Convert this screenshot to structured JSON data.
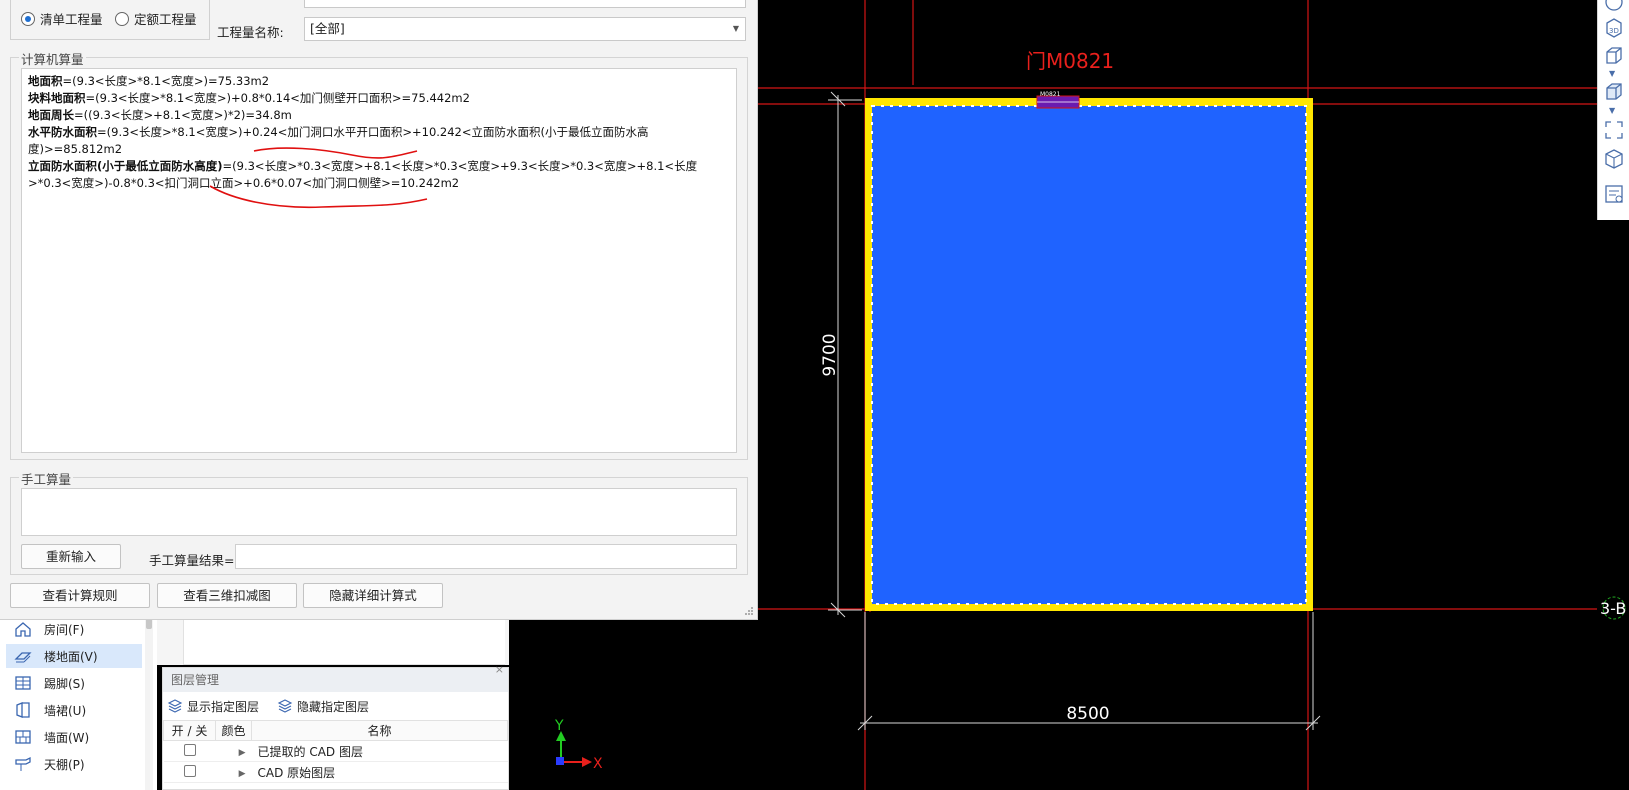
{
  "dialog": {
    "mode_options": [
      {
        "label": "清单工程量",
        "selected": true
      },
      {
        "label": "定额工程量",
        "selected": false
      }
    ],
    "quantity_name_label": "工程量名称:",
    "quantity_name_value": "[全部]",
    "computer_group_title": "计算机算量",
    "calc_lines": {
      "l1_bold": "地面积",
      "l1_rest": "=(9.3<长度>*8.1<宽度>)=75.33m2",
      "l2_bold": "块料地面积",
      "l2_rest": "=(9.3<长度>*8.1<宽度>)+0.8*0.14<加门侧壁开口面积>=75.442m2",
      "l3_bold": "地面周长",
      "l3_rest": "=((9.3<长度>+8.1<宽度>)*2)=34.8m",
      "l4_bold": "水平防水面积",
      "l4_rest": "=(9.3<长度>*8.1<宽度>)+0.24<加门洞口水平开口面积>+10.242<立面防水面积(小于最低立面防水高度)>=85.812m2",
      "l5_bold": "立面防水面积(小于最低立面防水高度)",
      "l5_rest": "=(9.3<长度>*0.3<宽度>+8.1<长度>*0.3<宽度>+9.3<长度>*0.3<宽度>+8.1<长度>*0.3<宽度>)-0.8*0.3<扣门洞口立面>+0.6*0.07<加门洞口侧壁>=10.242m2"
    },
    "manual_group_title": "手工算量",
    "reenter_button": "重新输入",
    "manual_result_label": "手工算量结果=",
    "footer_buttons": [
      "查看计算规则",
      "查看三维扣减图",
      "隐藏详细计算式"
    ]
  },
  "left_nav": {
    "items": [
      {
        "label": "房间(F)",
        "icon": "room-icon",
        "active": false
      },
      {
        "label": "楼地面(V)",
        "icon": "floor-icon",
        "active": true
      },
      {
        "label": "踢脚(S)",
        "icon": "skirting-icon",
        "active": false
      },
      {
        "label": "墙裙(U)",
        "icon": "wainscot-icon",
        "active": false
      },
      {
        "label": "墙面(W)",
        "icon": "wall-surface-icon",
        "active": false
      },
      {
        "label": "天棚(P)",
        "icon": "ceiling-icon",
        "active": false
      }
    ]
  },
  "layer_panel": {
    "title": "图层管理",
    "close_glyph": "×",
    "show_action": "显示指定图层",
    "hide_action": "隐藏指定图层",
    "columns": [
      "开 / 关",
      "颜色",
      "名称"
    ],
    "rows": [
      {
        "name": "已提取的 CAD 图层",
        "checked": false
      },
      {
        "name": "CAD 原始图层",
        "checked": false
      }
    ]
  },
  "cad": {
    "door_label": "门M0821",
    "door_small_label": "M0821",
    "dim_height": "9700",
    "dim_width": "8500",
    "axis_marker": "3-B",
    "axis_x": "X",
    "axis_y": "Y",
    "colors": {
      "background": "#000000",
      "floor_fill": "#1f63ff",
      "wall": "#ffe600",
      "axis_line": "#d31515",
      "dim_line": "#d8d8d8",
      "door": "#6a1bb0"
    }
  },
  "right_toolbar": {
    "icons": [
      "view-3d-icon",
      "cube-outline-icon",
      "cube-solid-icon",
      "fit-view-icon",
      "layer-3d-icon",
      "properties-icon"
    ]
  }
}
